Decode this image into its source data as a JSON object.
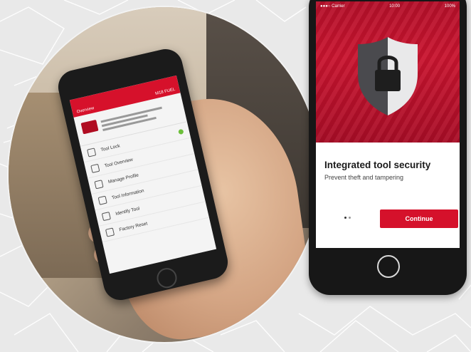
{
  "left_phone": {
    "topbar_left": "Overview",
    "topbar_right": "M18 FUEL",
    "menu": [
      {
        "label": "Tool Lock"
      },
      {
        "label": "Tool Overview"
      },
      {
        "label": "Manage Profile"
      },
      {
        "label": "Tool Information"
      },
      {
        "label": "Identify Tool"
      },
      {
        "label": "Factory Reset"
      }
    ]
  },
  "right_phone": {
    "status_left": "●●●○ Carrier",
    "status_center": "10:00",
    "status_right": "100%",
    "title": "Integrated tool security",
    "subtitle": "Prevent theft and tampering",
    "continue_label": "Continue"
  },
  "colors": {
    "brand_red": "#d5112b",
    "status_green": "#6cbf3a"
  }
}
